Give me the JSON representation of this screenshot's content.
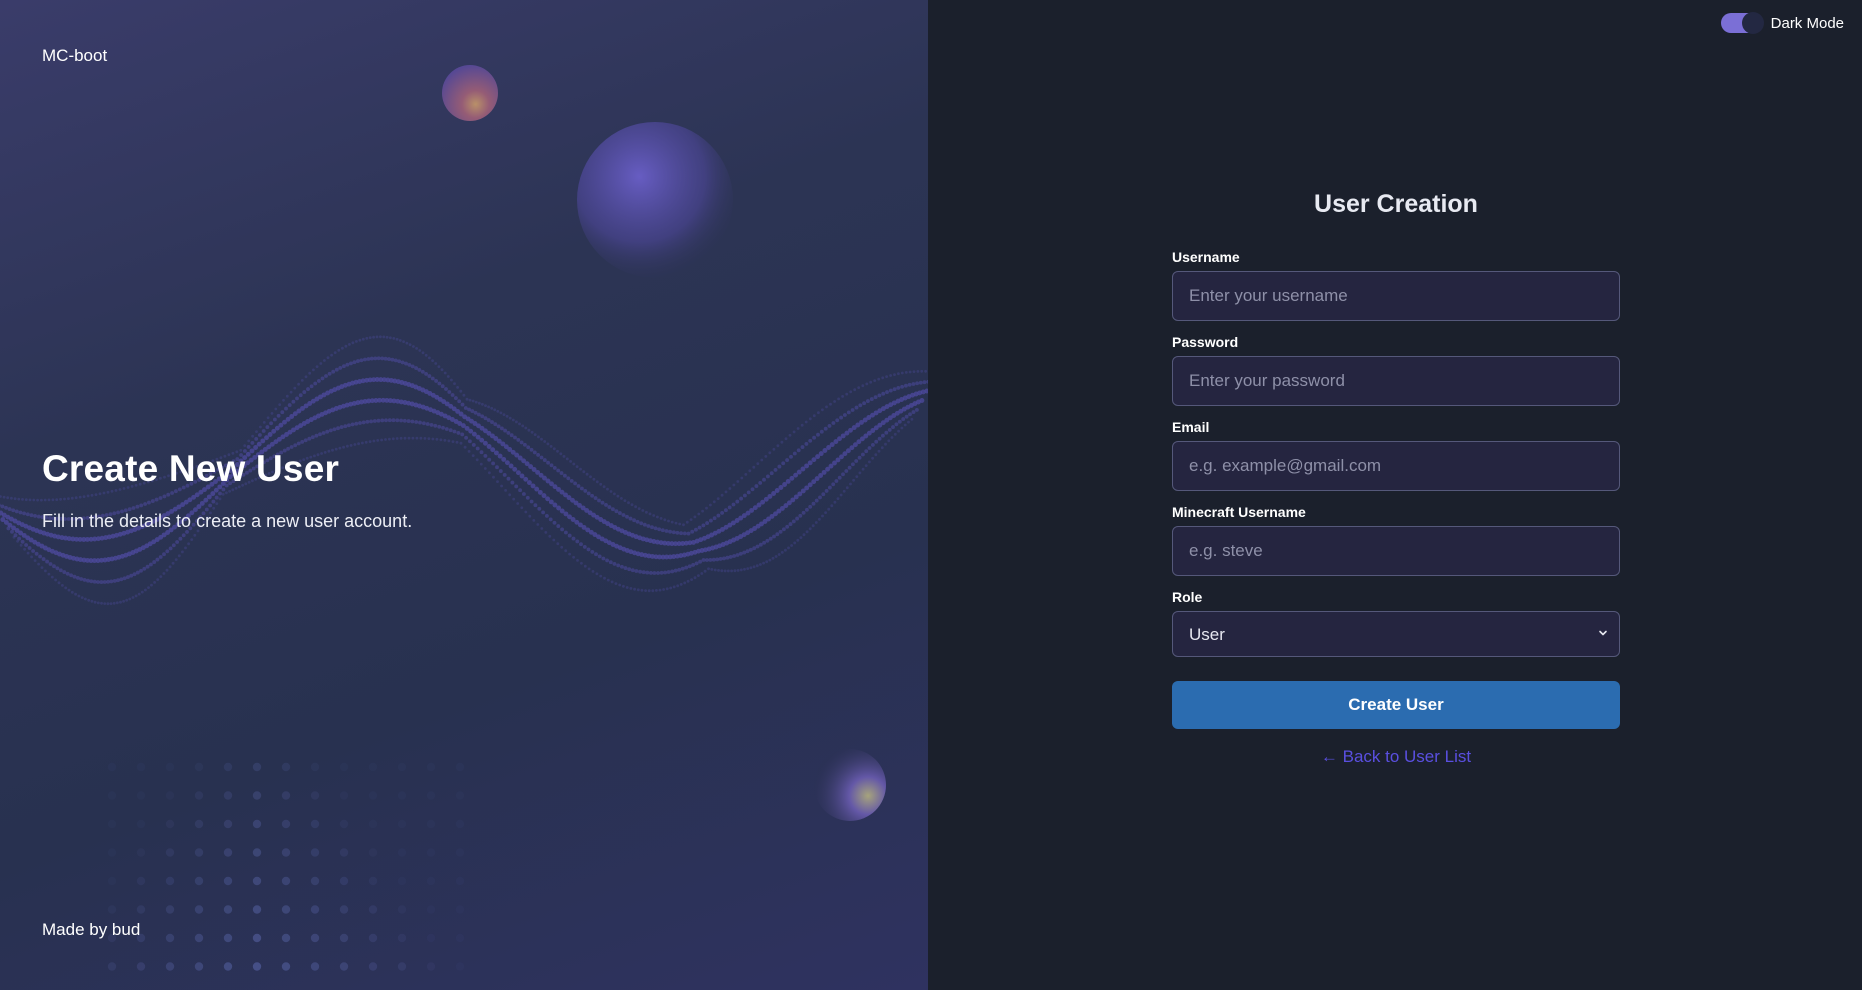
{
  "hero": {
    "brand": "MC-boot",
    "title": "Create New User",
    "subtitle": "Fill in the details to create a new user account.",
    "footer": "Made by bud"
  },
  "theme_toggle": {
    "label": "Dark Mode",
    "enabled": true
  },
  "form": {
    "title": "User Creation",
    "fields": {
      "username": {
        "label": "Username",
        "placeholder": "Enter your username",
        "value": ""
      },
      "password": {
        "label": "Password",
        "placeholder": "Enter your password",
        "value": ""
      },
      "email": {
        "label": "Email",
        "placeholder": "e.g. example@gmail.com",
        "value": ""
      },
      "minecraft": {
        "label": "Minecraft Username",
        "placeholder": "e.g. steve",
        "value": ""
      },
      "role": {
        "label": "Role",
        "selected": "User"
      }
    },
    "submit_label": "Create User",
    "back_link": "← Back to User List"
  },
  "colors": {
    "accent_button": "#2b6cb0",
    "link": "#5a4fe0",
    "toggle": "#7b6fd6",
    "panel_bg": "#1b202c",
    "input_bg": "#252540"
  }
}
